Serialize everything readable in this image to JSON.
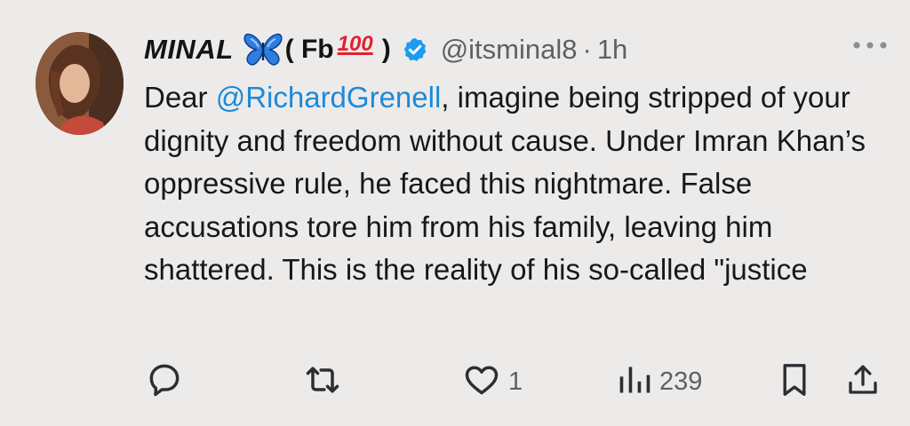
{
  "author": {
    "name": "MINAL",
    "name_suffix_open": "( Fb",
    "name_emoji_hundred": "100",
    "name_suffix_close": ")",
    "handle": "@itsminal8",
    "separator": "·",
    "time": "1h"
  },
  "tweet": {
    "text_prefix": "Dear ",
    "mention": "@RichardGrenell",
    "text_rest": ", imagine being stripped of your dignity and freedom without cause. Under Imran Khan’s oppressive rule, he faced this nightmare. False accusations tore him from his family, leaving him shattered. This is the reality of his so-called \"justice"
  },
  "actions": {
    "reply_count": "",
    "retweet_count": "",
    "like_count": "1",
    "views_count": "239"
  },
  "colors": {
    "background": "#edebea",
    "mention": "#1d8ad8",
    "verified": "#1d9bf0",
    "muted": "#5c6166",
    "hundred": "#e0212f"
  },
  "icons": [
    "butterfly-icon",
    "verified-badge-icon",
    "more-options-icon",
    "reply-icon",
    "retweet-icon",
    "like-icon",
    "views-icon",
    "bookmark-icon",
    "share-icon"
  ]
}
